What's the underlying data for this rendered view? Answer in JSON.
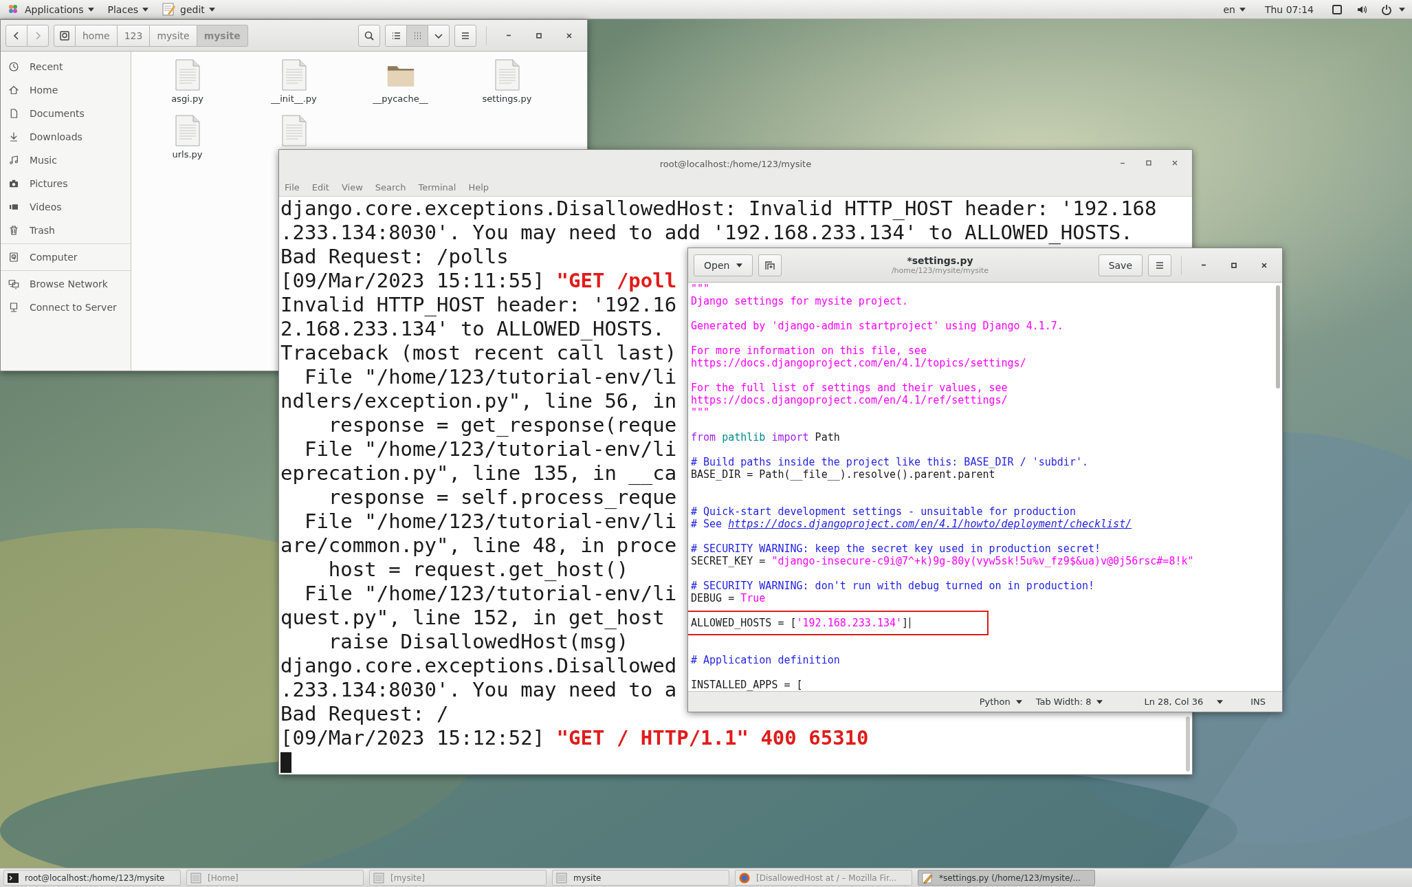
{
  "top_bar": {
    "menus": [
      {
        "label": "Applications",
        "kind": "apps"
      },
      {
        "label": "Places",
        "kind": "places"
      },
      {
        "label": "gedit",
        "kind": "app"
      }
    ],
    "language": "en",
    "clock": "Thu 07:14"
  },
  "file_manager": {
    "path": [
      {
        "label": "home",
        "selected": false
      },
      {
        "label": "123",
        "selected": false
      },
      {
        "label": "mysite",
        "selected": false
      },
      {
        "label": "mysite",
        "selected": true
      }
    ],
    "view_modes": [
      {
        "kind": "list",
        "selected": false
      },
      {
        "kind": "grid",
        "selected": true
      }
    ],
    "sidebar": {
      "sections": [
        {
          "items": [
            {
              "label": "Recent",
              "kind": "recent"
            },
            {
              "label": "Home",
              "kind": "home"
            },
            {
              "label": "Documents",
              "kind": "documents"
            },
            {
              "label": "Downloads",
              "kind": "downloads"
            },
            {
              "label": "Music",
              "kind": "music"
            },
            {
              "label": "Pictures",
              "kind": "pictures"
            },
            {
              "label": "Videos",
              "kind": "videos"
            },
            {
              "label": "Trash",
              "kind": "trash"
            }
          ]
        },
        {
          "items": [
            {
              "label": "Computer",
              "kind": "computer"
            }
          ]
        },
        {
          "items": [
            {
              "label": "Browse Network",
              "kind": "network"
            },
            {
              "label": "Connect to Server",
              "kind": "server"
            }
          ]
        }
      ]
    },
    "files": [
      {
        "name": "asgi.py",
        "kind": "file"
      },
      {
        "name": "__init__.py",
        "kind": "file"
      },
      {
        "name": "__pycache__",
        "kind": "folder"
      },
      {
        "name": "settings.py",
        "kind": "file"
      },
      {
        "name": "urls.py",
        "kind": "file"
      },
      {
        "kind": "file"
      }
    ]
  },
  "terminal": {
    "title": "root@localhost:/home/123/mysite",
    "menu": [
      "File",
      "Edit",
      "View",
      "Search",
      "Terminal",
      "Help"
    ],
    "lines": [
      {
        "text": "django.core.exceptions.DisallowedHost: Invalid HTTP_HOST header: '192.168"
      },
      {
        "text": ".233.134:8030'. You may need to add '192.168.233.134' to ALLOWED_HOSTS."
      },
      {
        "text": "Bad Request: /polls"
      },
      {
        "text": "[09/Mar/2023 15:11:55] ",
        "request": "\"GET /poll"
      },
      {
        "text": "Invalid HTTP_HOST header: '192.16"
      },
      {
        "text": "2.168.233.134' to ALLOWED_HOSTS."
      },
      {
        "text": "Traceback (most recent call last)"
      },
      {
        "text": "  File \"/home/123/tutorial-env/li"
      },
      {
        "text": "ndlers/exception.py\", line 56, in"
      },
      {
        "text": "    response = get_response(reque"
      },
      {
        "text": "  File \"/home/123/tutorial-env/li"
      },
      {
        "text": "eprecation.py\", line 135, in __ca"
      },
      {
        "text": "    response = self.process_reque"
      },
      {
        "text": "  File \"/home/123/tutorial-env/li"
      },
      {
        "text": "are/common.py\", line 48, in proce"
      },
      {
        "text": "    host = request.get_host()"
      },
      {
        "text": "  File \"/home/123/tutorial-env/li"
      },
      {
        "text": "quest.py\", line 152, in get_host"
      },
      {
        "text": "    raise DisallowedHost(msg)"
      },
      {
        "text": "django.core.exceptions.Disallowed"
      },
      {
        "text": ".233.134:8030'. You may need to a"
      },
      {
        "text": "Bad Request: /"
      },
      {
        "text": "[09/Mar/2023 15:12:52] ",
        "request": "\"GET / HTTP/1.1\" 400 65310"
      }
    ]
  },
  "gedit": {
    "open_label": "Open",
    "title": "*settings.py",
    "subtitle": "/home/123/mysite/mysite",
    "save_label": "Save",
    "lines": [
      {
        "kind": "code",
        "highlighted": false,
        "cursor": false,
        "tokens": [
          {
            "text": "\"\"\"",
            "kind": "string"
          }
        ]
      },
      {
        "kind": "code",
        "highlighted": false,
        "cursor": false,
        "tokens": [
          {
            "text": "Django settings for mysite project.",
            "kind": "string"
          }
        ]
      },
      {
        "kind": "blank",
        "highlighted": false,
        "cursor": false
      },
      {
        "kind": "code",
        "highlighted": false,
        "cursor": false,
        "tokens": [
          {
            "text": "Generated by 'django-admin startproject' using Django 4.1.7.",
            "kind": "string"
          }
        ]
      },
      {
        "kind": "blank",
        "highlighted": false,
        "cursor": false
      },
      {
        "kind": "code",
        "highlighted": false,
        "cursor": false,
        "tokens": [
          {
            "text": "For more information on this file, see",
            "kind": "string"
          }
        ]
      },
      {
        "kind": "code",
        "highlighted": false,
        "cursor": false,
        "tokens": [
          {
            "text": "https://docs.djangoproject.com/en/4.1/topics/settings/",
            "kind": "string"
          }
        ]
      },
      {
        "kind": "blank",
        "highlighted": false,
        "cursor": false
      },
      {
        "kind": "code",
        "highlighted": false,
        "cursor": false,
        "tokens": [
          {
            "text": "For the full list of settings and their values, see",
            "kind": "string"
          }
        ]
      },
      {
        "kind": "code",
        "highlighted": false,
        "cursor": false,
        "tokens": [
          {
            "text": "https://docs.djangoproject.com/en/4.1/ref/settings/",
            "kind": "string"
          }
        ]
      },
      {
        "kind": "code",
        "highlighted": false,
        "cursor": false,
        "tokens": [
          {
            "text": "\"\"\"",
            "kind": "string"
          }
        ]
      },
      {
        "kind": "blank",
        "highlighted": false,
        "cursor": false
      },
      {
        "kind": "code",
        "highlighted": false,
        "cursor": false,
        "tokens": [
          {
            "text": "from",
            "kind": "keyword"
          },
          {
            "text": " pathlib",
            "kind": "module"
          },
          {
            "text": " import",
            "kind": "keyword"
          },
          {
            "text": " Path",
            "kind": "plain"
          }
        ]
      },
      {
        "kind": "blank",
        "highlighted": false,
        "cursor": false
      },
      {
        "kind": "code",
        "highlighted": false,
        "cursor": false,
        "tokens": [
          {
            "text": "# Build paths inside the project like this: BASE_DIR / 'subdir'.",
            "kind": "comment"
          }
        ]
      },
      {
        "kind": "code",
        "highlighted": false,
        "cursor": false,
        "tokens": [
          {
            "text": "BASE_DIR = Path(__file__).resolve().parent.parent",
            "kind": "plain"
          }
        ]
      },
      {
        "kind": "blank",
        "highlighted": false,
        "cursor": false
      },
      {
        "kind": "blank",
        "highlighted": false,
        "cursor": false
      },
      {
        "kind": "code",
        "highlighted": false,
        "cursor": false,
        "tokens": [
          {
            "text": "# Quick-start development settings - unsuitable for production",
            "kind": "comment"
          }
        ]
      },
      {
        "kind": "code",
        "highlighted": false,
        "cursor": false,
        "tokens": [
          {
            "text": "# See ",
            "kind": "comment"
          },
          {
            "text": "https://docs.djangoproject.com/en/4.1/howto/deployment/checklist/",
            "kind": "link"
          }
        ]
      },
      {
        "kind": "blank",
        "highlighted": false,
        "cursor": false
      },
      {
        "kind": "code",
        "highlighted": false,
        "cursor": false,
        "tokens": [
          {
            "text": "# SECURITY WARNING: keep the secret key used in production secret!",
            "kind": "comment"
          }
        ]
      },
      {
        "kind": "code",
        "highlighted": false,
        "cursor": false,
        "tokens": [
          {
            "text": "SECRET_KEY = ",
            "kind": "plain"
          },
          {
            "text": "\"django-insecure-c9i@7^+k)9g-80y(vyw5sk!5u%v_fz9$&ua)v@0j56rsc#=8!k\"",
            "kind": "string"
          }
        ]
      },
      {
        "kind": "blank",
        "highlighted": false,
        "cursor": false
      },
      {
        "kind": "code",
        "highlighted": false,
        "cursor": false,
        "tokens": [
          {
            "text": "# SECURITY WARNING: don't run with debug turned on in production!",
            "kind": "comment"
          }
        ]
      },
      {
        "kind": "code",
        "highlighted": false,
        "cursor": false,
        "tokens": [
          {
            "text": "DEBUG = ",
            "kind": "plain"
          },
          {
            "text": "True",
            "kind": "constant"
          }
        ]
      },
      {
        "kind": "blank",
        "highlighted": false,
        "cursor": false
      },
      {
        "kind": "code",
        "highlighted": true,
        "cursor": true,
        "tokens": [
          {
            "text": "ALLOWED_HOSTS = [",
            "kind": "plain"
          },
          {
            "text": "'192.168.233.134'",
            "kind": "string"
          },
          {
            "text": "]",
            "kind": "plain"
          }
        ]
      },
      {
        "kind": "blank",
        "highlighted": false,
        "cursor": false
      },
      {
        "kind": "blank",
        "highlighted": false,
        "cursor": false
      },
      {
        "kind": "code",
        "highlighted": false,
        "cursor": false,
        "tokens": [
          {
            "text": "# Application definition",
            "kind": "comment"
          }
        ]
      },
      {
        "kind": "blank",
        "highlighted": false,
        "cursor": false
      },
      {
        "kind": "code",
        "highlighted": false,
        "cursor": false,
        "tokens": [
          {
            "text": "INSTALLED_APPS = [",
            "kind": "plain"
          }
        ]
      }
    ],
    "status": {
      "language": "Python",
      "tab_width": "Tab Width: 8",
      "position": "Ln 28, Col 36",
      "mode": "INS"
    }
  },
  "taskbar": [
    {
      "label": "root@localhost:/home/123/mysite",
      "kind": "terminal",
      "selected": false,
      "minimized": false
    },
    {
      "label": "[Home]",
      "kind": "folder",
      "selected": false,
      "minimized": true
    },
    {
      "label": "[mysite]",
      "kind": "folder",
      "selected": false,
      "minimized": true
    },
    {
      "label": "mysite",
      "kind": "folder",
      "selected": false,
      "minimized": false
    },
    {
      "label": "[DisallowedHost at / – Mozilla Fir...",
      "kind": "browser",
      "selected": false,
      "minimized": true
    },
    {
      "label": "*settings.py (/home/123/mysite/...",
      "kind": "editor",
      "selected": true,
      "minimized": false
    }
  ]
}
